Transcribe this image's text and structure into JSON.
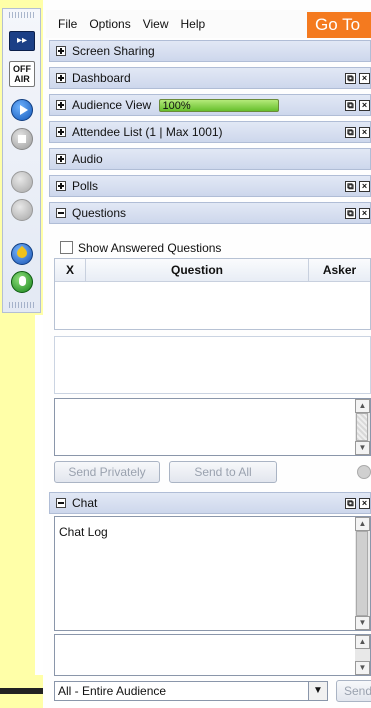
{
  "menu": [
    "File",
    "Options",
    "View",
    "Help"
  ],
  "goto_label": "Go To",
  "toolbar": {
    "off_air_line1": "OFF",
    "off_air_line2": "AIR",
    "expand_glyph": "▸▸"
  },
  "sections": {
    "screen_sharing": "Screen Sharing",
    "dashboard": "Dashboard",
    "audience_view": "Audience View",
    "audience_view_level": "100%",
    "attendee_list": "Attendee List",
    "attendee_count": "(1 | Max 1001)",
    "audio": "Audio",
    "polls": "Polls",
    "questions": "Questions",
    "chat": "Chat"
  },
  "questions": {
    "show_answered_label": "Show Answered Questions",
    "columns": [
      "X",
      "Question",
      "Asker"
    ],
    "send_privately": "Send Privately",
    "send_to_all": "Send to All"
  },
  "chat": {
    "log_label": "Chat Log",
    "audience_value": "All - Entire Audience",
    "send_label": "Send"
  },
  "colors": {
    "accent_orange": "#f47a1f",
    "header_blue": "#d6deef",
    "progress_green": "#7ccb3a",
    "toolbar_yellow": "#ffffa8"
  }
}
